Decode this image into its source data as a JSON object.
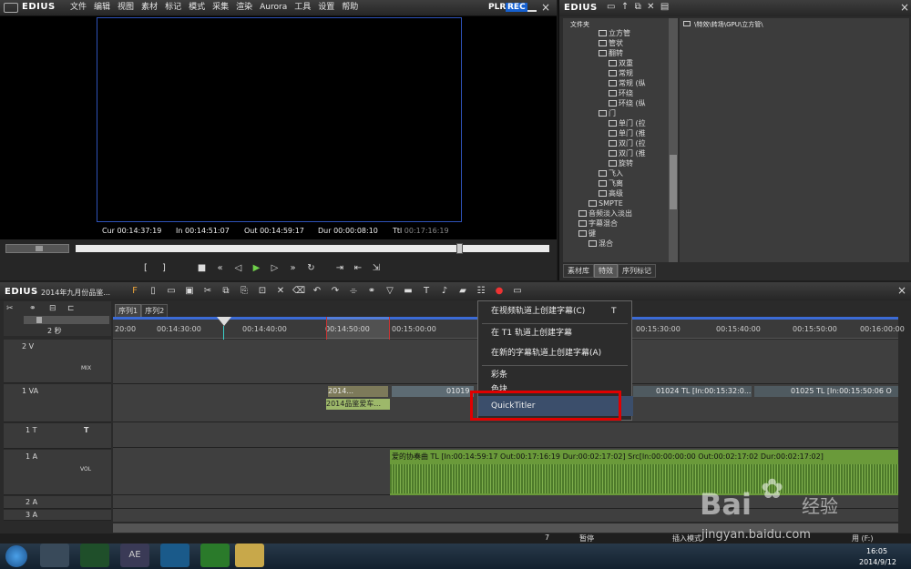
{
  "app": {
    "name": "EDIUS"
  },
  "menu": [
    "文件",
    "编辑",
    "视图",
    "素材",
    "标记",
    "模式",
    "采集",
    "渲染",
    "Aurora",
    "工具",
    "设置",
    "帮助"
  ],
  "player": {
    "plr": "PLR",
    "rec": "REC",
    "tc": [
      {
        "label": "Cur",
        "value": "00:14:37:19"
      },
      {
        "label": "In",
        "value": "00:14:51:07"
      },
      {
        "label": "Out",
        "value": "00:14:59:17"
      },
      {
        "label": "Dur",
        "value": "00:00:08:10"
      },
      {
        "label": "Ttl",
        "value": "00:17:16:19"
      }
    ]
  },
  "library": {
    "header": "EDIUS",
    "folder_col": "文件夹",
    "path": "\\特效\\转场\\GPU\\立方管\\",
    "tree": [
      {
        "label": "立方管",
        "indent": 3
      },
      {
        "label": "管状",
        "indent": 3
      },
      {
        "label": "翻转",
        "indent": 3
      },
      {
        "label": "双重",
        "indent": 4
      },
      {
        "label": "常规",
        "indent": 4
      },
      {
        "label": "常规 (纵",
        "indent": 4
      },
      {
        "label": "环绕",
        "indent": 4
      },
      {
        "label": "环绕 (纵",
        "indent": 4
      },
      {
        "label": "门",
        "indent": 3
      },
      {
        "label": "单门 (拉",
        "indent": 4
      },
      {
        "label": "单门 (推",
        "indent": 4
      },
      {
        "label": "双门 (拉",
        "indent": 4
      },
      {
        "label": "双门 (推",
        "indent": 4
      },
      {
        "label": "旋转",
        "indent": 4
      },
      {
        "label": "飞入",
        "indent": 3
      },
      {
        "label": "飞离",
        "indent": 3
      },
      {
        "label": "高级",
        "indent": 3
      },
      {
        "label": "SMPTE",
        "indent": 2
      },
      {
        "label": "音频淡入淡出",
        "indent": 1
      },
      {
        "label": "字幕混合",
        "indent": 1
      },
      {
        "label": "键",
        "indent": 1
      },
      {
        "label": "混合",
        "indent": 2
      }
    ],
    "tabs": [
      "素材库",
      "特效",
      "序列标记"
    ]
  },
  "timeline": {
    "app": "EDIUS",
    "project": "2014年九月份品鉴...",
    "seq_tabs": [
      "序列1",
      "序列2"
    ],
    "scale": "2 秒",
    "ticks": [
      "00:14:30:00",
      "00:14:40:00",
      "00:14:50:00",
      "00:15:00:00",
      "00:15:30:00",
      "00:15:40:00",
      "00:15:50:00",
      "00:16:00:00"
    ],
    "tick0": "20:00",
    "tracks": [
      {
        "name": "2 V",
        "tag": "MIX"
      },
      {
        "name": "1 VA",
        "tag": ""
      },
      {
        "name": "1 T",
        "tag": "T"
      },
      {
        "name": "1 A",
        "tag": "VOL"
      },
      {
        "name": "2 A",
        "tag": ""
      },
      {
        "name": "3 A",
        "tag": ""
      }
    ],
    "clips": {
      "va1": "2014...",
      "va2": "01019",
      "va3": "01024  TL [In:00:15:32:0...",
      "va4": "01025  TL [In:00:15:50:06 O",
      "va_label": "2014品鉴爱车...",
      "audio": "爱的协奏曲  TL [In:00:14:59:17 Out:00:17:16:19 Dur:00:02:17:02]  Src[In:00:00:00:00 Out:00:02:17:02 Dur:00:02:17:02]"
    }
  },
  "context_menu": [
    {
      "label": "在视频轨道上创建字幕(C)",
      "shortcut": "T"
    },
    {
      "label": "在 T1 轨道上创建字幕",
      "shortcut": ""
    },
    {
      "label": "在新的字幕轨道上创建字幕(A)",
      "shortcut": ""
    },
    {
      "label": "彩条",
      "shortcut": ""
    },
    {
      "label": "色块",
      "shortcut": ""
    },
    {
      "label": "QuickTitler",
      "shortcut": ""
    }
  ],
  "status": {
    "a": "7",
    "b": "暂停",
    "c": "插入模式",
    "d": "用 (F:)"
  },
  "taskbar": {
    "ae": "AE",
    "time": "16:05",
    "date": "2014/9/12"
  },
  "watermark": {
    "brand": "Bai",
    "paw": "经验",
    "url": "jingyan.baidu.com"
  },
  "colors": {
    "accent": "#e00000",
    "track_green": "#6a9a3a",
    "ruler_sel": "#3b6bd6"
  }
}
